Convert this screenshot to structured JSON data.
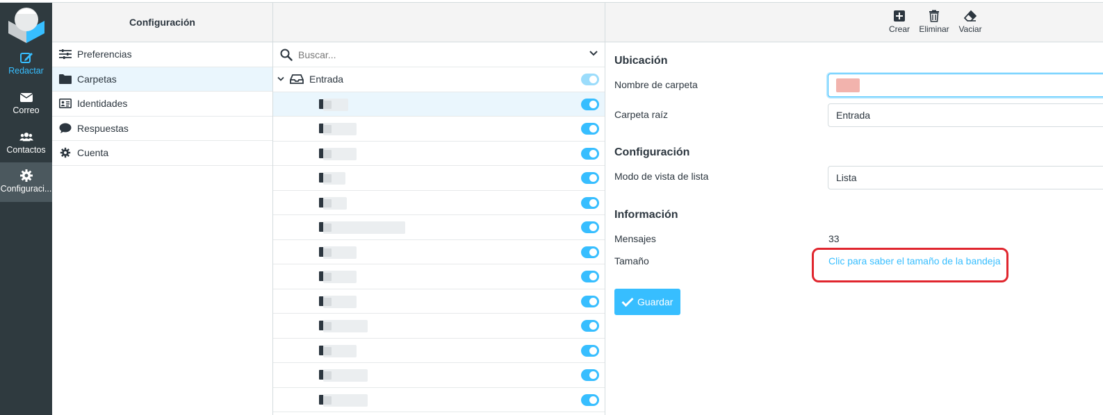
{
  "taskmenu": {
    "items": [
      {
        "label": "Redactar"
      },
      {
        "label": "Correo"
      },
      {
        "label": "Contactos"
      },
      {
        "label": "Configuraci..."
      }
    ]
  },
  "settings_menu": {
    "title": "Configuración",
    "items": [
      {
        "label": "Preferencias"
      },
      {
        "label": "Carpetas"
      },
      {
        "label": "Identidades"
      },
      {
        "label": "Respuestas"
      },
      {
        "label": "Cuenta"
      }
    ]
  },
  "folders": {
    "search_placeholder": "Buscar...",
    "root": "Entrada",
    "subfolder_count": 13
  },
  "toolbar": {
    "create": "Crear",
    "delete": "Eliminar",
    "empty": "Vaciar"
  },
  "form": {
    "location_title": "Ubicación",
    "folder_name_label": "Nombre de carpeta",
    "parent_label": "Carpeta raíz",
    "parent_value": "Entrada",
    "config_title": "Configuración",
    "view_mode_label": "Modo de vista de lista",
    "view_mode_value": "Lista",
    "info_title": "Información",
    "messages_label": "Mensajes",
    "messages_value": "33",
    "size_label": "Tamaño",
    "size_link": "Clic para saber el tamaño de la bandeja",
    "save_label": "Guardar"
  },
  "colors": {
    "accent": "#37beff",
    "sidebar": "#2f3a3f",
    "highlight": "#e0262e"
  }
}
